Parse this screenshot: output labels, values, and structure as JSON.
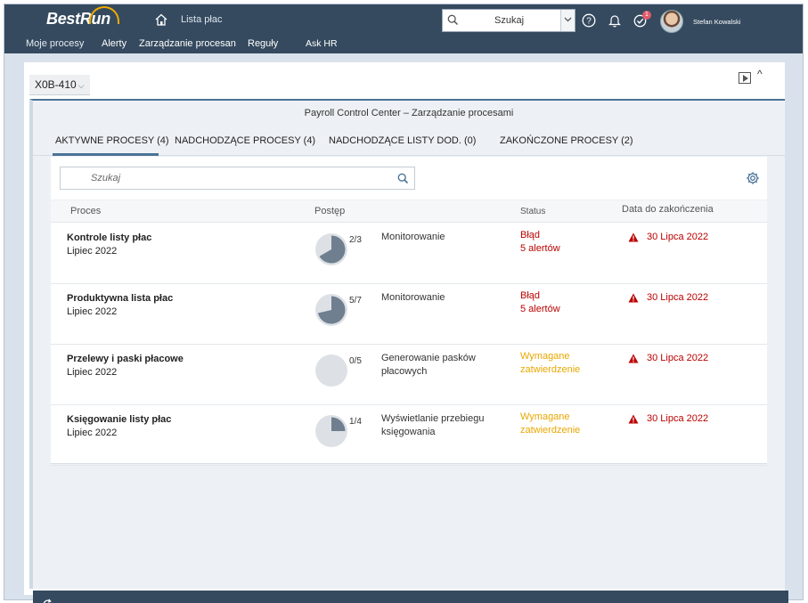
{
  "shell": {
    "logo": "BestRun",
    "app_title": "Lista płac",
    "search_label": "Szukaj",
    "notification_count": "1",
    "user_name": "Stefan Kowalski",
    "nav": [
      "Moje procesy",
      "Alerty",
      "Zarządzanie procesan",
      "Reguły",
      "Ask HR"
    ]
  },
  "card": {
    "variant": "X0B-410",
    "panel_title": "Payroll Control Center – Zarządzanie procesami",
    "tabs": [
      {
        "label": "AKTYWNE PROCESY (4)"
      },
      {
        "label": "NADCHODZĄCE PROCESY (4)"
      },
      {
        "label": "NADCHODZĄCE LISTY DOD. (0)"
      },
      {
        "label": "ZAKOŃCZONE PROCESY (2)"
      }
    ],
    "search_placeholder": "Szukaj",
    "columns": {
      "process": "Proces",
      "progress": "Postęp",
      "status": "Status",
      "due_date": "Data do zakończenia"
    },
    "rows": [
      {
        "name": "Kontrole listy płac",
        "period": "Lipiec 2022",
        "progress_label": "2/3",
        "progress": 0.667,
        "activity": "Monitorowanie",
        "status": "Błąd",
        "status_detail": "5 alertów",
        "status_color": "#bb0000",
        "due_date": "30 Lipca 2022"
      },
      {
        "name": "Produktywna lista płac",
        "period": "Lipiec 2022",
        "progress_label": "5/7",
        "progress": 0.714,
        "activity": "Monitorowanie",
        "status": "Błąd",
        "status_detail": "5 alertów",
        "status_color": "#bb0000",
        "due_date": "30 Lipca 2022"
      },
      {
        "name": "Przelewy i paski płacowe",
        "period": "Lipiec 2022",
        "progress_label": "0/5",
        "progress": 0,
        "activity": "Generowanie pasków płacowych",
        "status": "Wymagane",
        "status_detail": "zatwierdzenie",
        "status_color": "#e9a700",
        "due_date": "30 Lipca 2022"
      },
      {
        "name": "Księgowanie listy płac",
        "period": "Lipiec 2022",
        "progress_label": "1/4",
        "progress": 0.25,
        "activity": "Wyświetlanie przebiegu księgowania",
        "status": "Wymagane",
        "status_detail": "zatwierdzenie",
        "status_color": "#e9a700",
        "due_date": "30 Lipca 2022"
      }
    ]
  },
  "colors": {
    "shell": "#354a5f",
    "accent": "#4a7398",
    "error": "#bb0000",
    "warning": "#e9a700",
    "pie_track": "#dde1e5",
    "pie_fill": "#6f7f8f"
  },
  "icons": [
    "home-icon",
    "search-icon",
    "chevron-down-icon",
    "help-icon",
    "bell-icon",
    "task-check-icon",
    "play-icon",
    "collapse-icon",
    "gear-icon",
    "warning-icon",
    "refresh-icon"
  ]
}
